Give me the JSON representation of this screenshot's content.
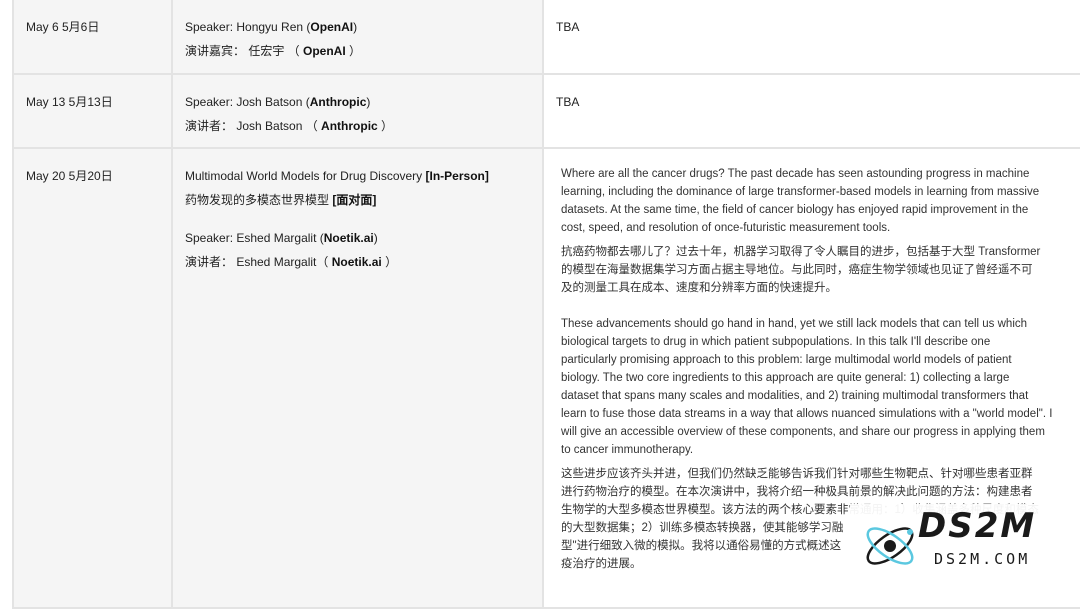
{
  "rows": [
    {
      "date": "May 6  5月6日",
      "speaker_en_prefix": "Speaker: Hongyu Ren (",
      "speaker_en_org": "OpenAI",
      "speaker_en_suffix": ")",
      "speaker_zh_prefix": "演讲嘉宾： 任宏宇 （ ",
      "speaker_zh_org": "OpenAI",
      "speaker_zh_suffix": " ）",
      "abstract": "TBA"
    },
    {
      "date": "May 13  5月13日",
      "speaker_en_prefix": "Speaker: Josh Batson (",
      "speaker_en_org": "Anthropic",
      "speaker_en_suffix": ")",
      "speaker_zh_prefix": "演讲者： Josh Batson （ ",
      "speaker_zh_org": "Anthropic",
      "speaker_zh_suffix": " ）",
      "abstract": "TBA"
    },
    {
      "date": "May 20  5月20日",
      "title_en": "Multimodal World Models for Drug Discovery ",
      "title_en_tag": "[In-Person]",
      "title_zh": "药物发现的多模态世界模型 ",
      "title_zh_tag": "[面对面]",
      "speaker_en_prefix": "Speaker: Eshed Margalit (",
      "speaker_en_org": "Noetik.ai",
      "speaker_en_suffix": ")",
      "speaker_zh_prefix": "演讲者： Eshed Margalit（ ",
      "speaker_zh_org": "Noetik.ai",
      "speaker_zh_suffix": " ）",
      "abstract_lines_1_en": [
        "Where are all the cancer drugs? The past decade has seen astounding progress in machine",
        "learning, including the dominance of large transformer-based models in learning from massive",
        "datasets. At the same time, the field of cancer biology has enjoyed rapid improvement in the",
        "cost, speed, and resolution of once-futuristic measurement tools."
      ],
      "abstract_lines_1_zh": [
        "抗癌药物都去哪儿了？过去十年，机器学习取得了令人瞩目的进步，包括基于大型 Transformer",
        "的模型在海量数据集学习方面占据主导地位。与此同时，癌症生物学领域也见证了曾经遥不可",
        "及的测量工具在成本、速度和分辨率方面的快速提升。"
      ],
      "abstract_lines_2_en": [
        "These advancements should go hand in hand, yet we still lack models that can tell us which",
        "biological targets to drug in which patient subpopulations. In this talk I'll describe one",
        "particularly promising approach to this problem: large multimodal world models of patient",
        "biology. The two core ingredients to this approach are quite general: 1) collecting a large",
        "dataset that spans many scales and modalities, and 2) training multimodal transformers that",
        "learn to fuse those data streams in a way that allows nuanced simulations with a \"world model\". I",
        "will give an accessible overview of these components, and share our progress in applying them",
        "to cancer immunotherapy."
      ],
      "abstract_lines_2_zh": [
        "这些进步应该齐头并进，但我们仍然缺乏能够告诉我们针对哪些生物靶点、针对哪些患者亚群",
        "进行药物治疗的模型。在本次演讲中，我将介绍一种极具前景的解决此问题的方法：构建患者",
        "生物学的大型多模态世界模型。该方法的两个核心要素非常通用：1）收集涵盖多种尺度和模态",
        "的大型数据集；2）训练多模态转换器，使其能够学习融",
        "型\"进行细致入微的模拟。我将以通俗易懂的方式概述这",
        "疫治疗的进展。"
      ]
    }
  ],
  "watermark": {
    "big": "DS2M",
    "small": "DS2M.COM"
  }
}
